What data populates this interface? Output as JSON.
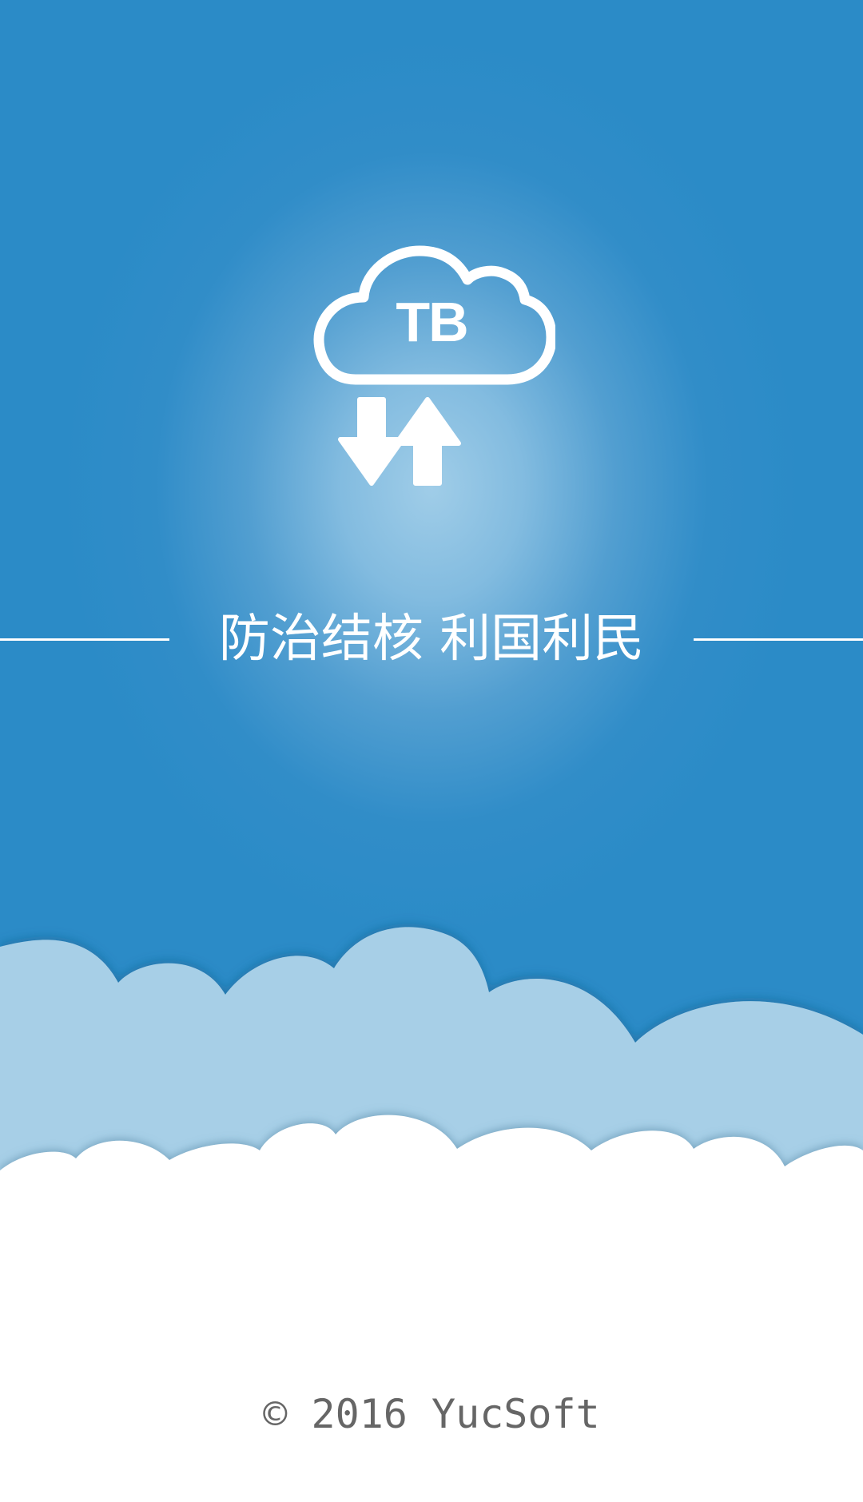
{
  "splash": {
    "logo": {
      "icon": "cloud-transfer-icon",
      "text": "TB",
      "download_icon": "arrow-down-icon",
      "upload_icon": "arrow-up-icon"
    },
    "slogan": "防治结核  利国利民",
    "copyright": "©  2016 YucSoft"
  },
  "colors": {
    "sky": "#2b8bc7",
    "sky_glow": "#a0cde8",
    "back_clouds": "#a7cfe7",
    "front_clouds": "#ffffff",
    "copyright_text": "#666666"
  }
}
